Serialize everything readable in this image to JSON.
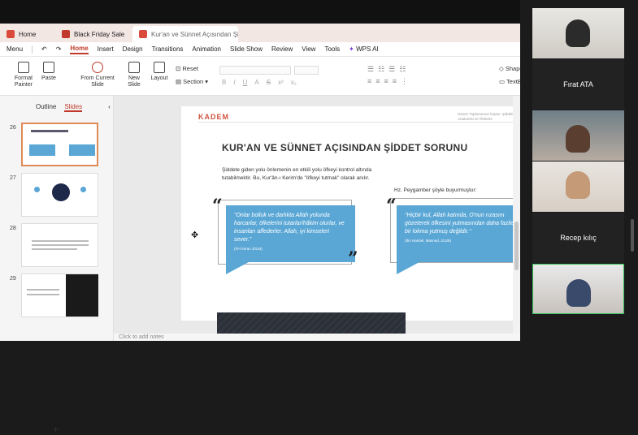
{
  "tabs": [
    {
      "label": "Home"
    },
    {
      "label": "Black Friday Sale"
    },
    {
      "label": "Kur'an ve Sünnet Açısından Şiddet..."
    }
  ],
  "menu": {
    "menu_label": "Menu",
    "items": [
      "Home",
      "Insert",
      "Design",
      "Transitions",
      "Animation",
      "Slide Show",
      "Review",
      "View",
      "Tools"
    ],
    "wps_ai": "WPS AI"
  },
  "ribbon": {
    "format_painter": "Format Painter",
    "paste": "Paste",
    "from_current_slide": "From Current Slide",
    "new_slide": "New Slide",
    "layout": "Layout",
    "reset": "Reset",
    "section": "Section",
    "shapes": "Shape",
    "textbox": "TextBo"
  },
  "panel": {
    "outline_tab": "Outline",
    "slides_tab": "Slides",
    "slide_numbers": [
      "26",
      "27",
      "28",
      "29"
    ]
  },
  "slide": {
    "brand": "KADEM",
    "header_text": "Güven Toplumunun İnşası: Şiddetin Anatomisi ve Önleme",
    "title": "KUR'AN VE SÜNNET AÇISINDAN ŞİDDET SORUNU",
    "intro": "Şiddete giden yolu önlemenin en etkili yolu öfkeyi kontrol altında tutabilmektir. Bu, Kur'ân-ı Kerim'de \"öfkeyi tutmak\" olarak anılır.",
    "right_intro": "Hz. Peygamber şöyle buyurmuştur:",
    "quote_left": "\"Onlar bolluk ve darlıkta Allah yolunda harcarlar, öfkelerini tutarlar/hâkim olurlar, ve insanları affederler. Allah, iyi kimseleri sever.\"",
    "quote_left_source": "(Âl-i İmran 3/134)",
    "quote_right": "\"Hiçbir kul, Allah katında, O'nun rızasını gözeterek öfkesini yutmasından daha faziletli bir lokma yutmuş değildir.\"",
    "quote_right_source": "(İbn Hanbel, Müsned, 2/128)"
  },
  "notes_placeholder": "Click to add notes",
  "participants": {
    "p2": "Fırat ATA",
    "p5": "Recep kılıç"
  }
}
